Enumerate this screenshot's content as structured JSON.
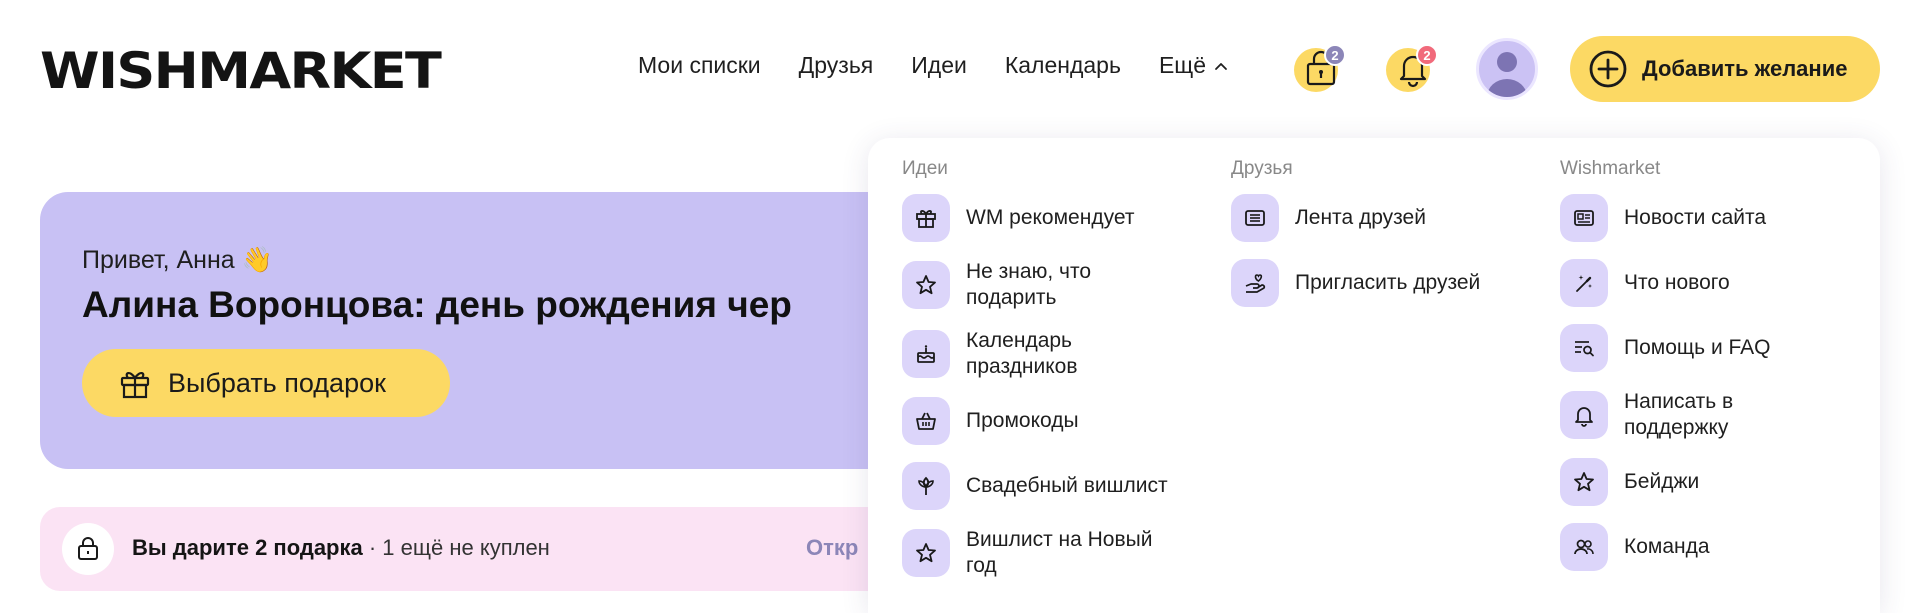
{
  "logo": "WISHMARKET",
  "nav": {
    "items": [
      "Мои списки",
      "Друзья",
      "Идеи",
      "Календарь"
    ],
    "more": "Ещё"
  },
  "header": {
    "gift_badge": "2",
    "bell_badge": "2",
    "add_button": "Добавить желание"
  },
  "hero": {
    "greeting": "Привет, Анна 👋",
    "title": "Алина Воронцова: день рождения чер",
    "button": "Выбрать подарок"
  },
  "gift_bar": {
    "bold": "Вы дарите 2 подарка",
    "rest": " · 1 ещё не куплен",
    "link": "Откр"
  },
  "dropdown": {
    "ideas": {
      "title": "Идеи",
      "items": [
        "WM рекомендует",
        "Не знаю, что подарить",
        "Календарь праздников",
        "Промокоды",
        "Свадебный вишлист",
        "Вишлист на Новый год"
      ]
    },
    "friends": {
      "title": "Друзья",
      "items": [
        "Лента друзей",
        "Пригласить друзей"
      ]
    },
    "wishmarket": {
      "title": "Wishmarket",
      "items": [
        "Новости сайта",
        "Что нового",
        "Помощь и FAQ",
        "Написать в поддержку",
        "Бейджи",
        "Команда"
      ]
    }
  },
  "colors": {
    "accent_yellow": "#fcd964",
    "lavender": "#c8c1f4",
    "icon_tile": "#dcd5fa",
    "pink": "#fbe3f4",
    "muted_link": "#8c86b8"
  }
}
